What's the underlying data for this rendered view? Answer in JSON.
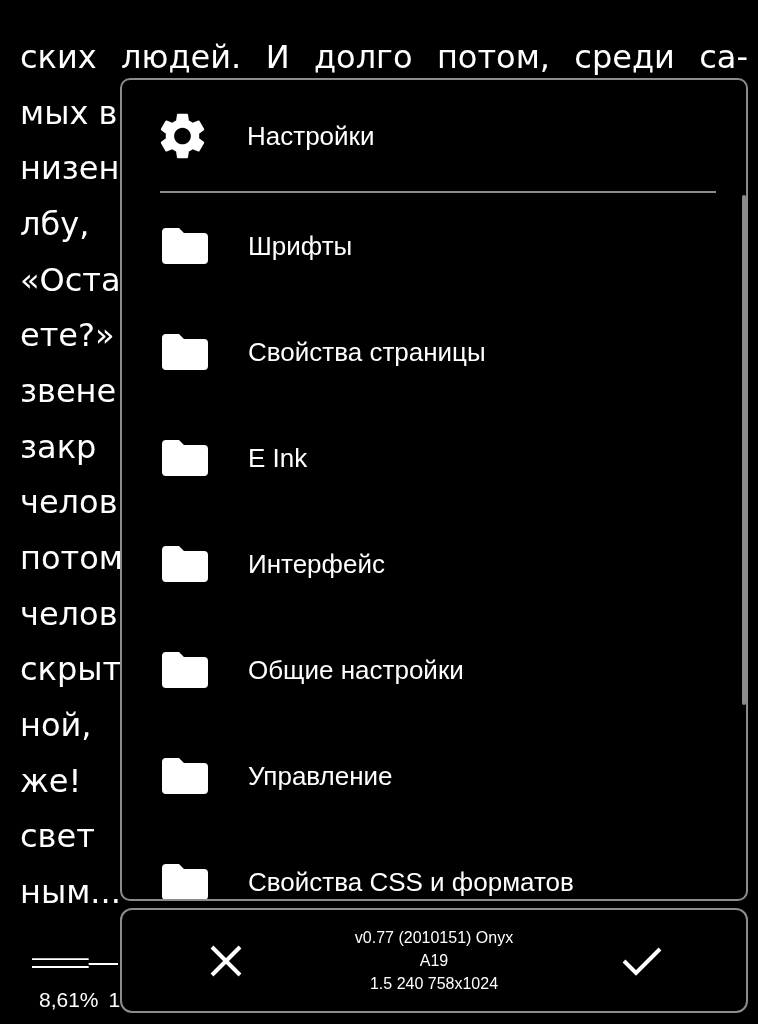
{
  "book_page": {
    "lines": [
      "ских людей. И долго потом, среди са-",
      "мых в",
      "низен",
      "лбу,",
      "«Оста",
      "ете?»",
      "звене",
      "закр",
      "челов",
      "потом",
      "челов",
      "скрыт",
      "ной,",
      "же!",
      "свет",
      "ным..."
    ],
    "progress_percent": "8,61%",
    "page_number": "1"
  },
  "dialog": {
    "title": "Настройки",
    "items": [
      {
        "label": "Шрифты"
      },
      {
        "label": "Свойства страницы"
      },
      {
        "label": "E Ink"
      },
      {
        "label": "Интерфейс"
      },
      {
        "label": "Общие настройки"
      },
      {
        "label": "Управление"
      },
      {
        "label": "Свойства CSS и форматов"
      }
    ],
    "footer": {
      "version_lines": [
        "v0.77 (2010151) Onyx",
        "A19",
        "1.5 240 758x1024"
      ]
    }
  }
}
